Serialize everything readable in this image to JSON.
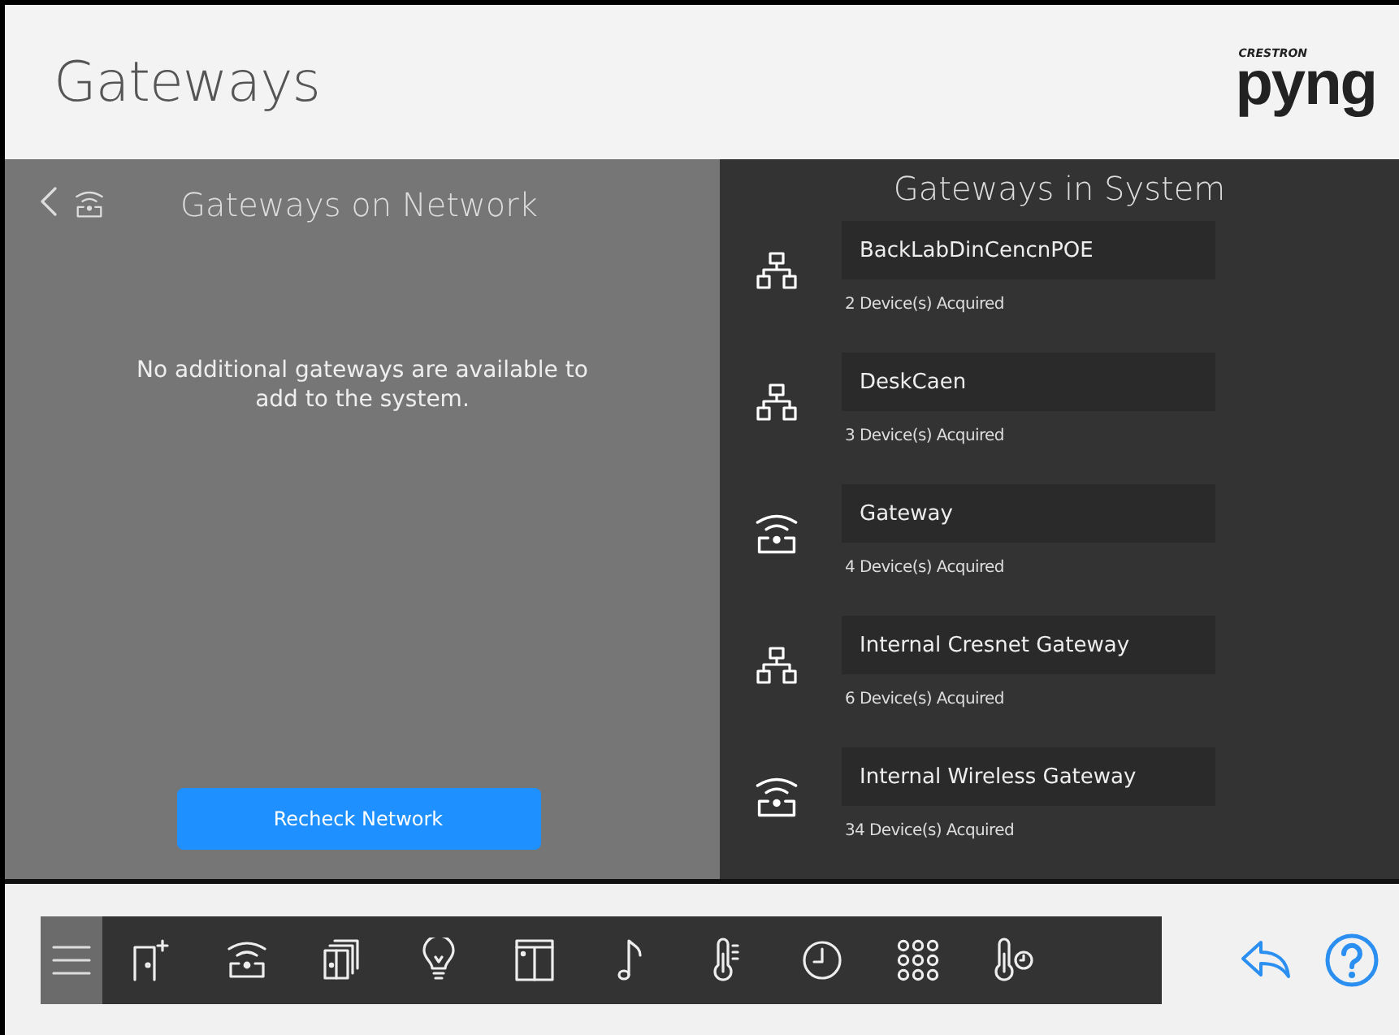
{
  "header": {
    "title": "Gateways",
    "logo": {
      "brand": "CRESTRON",
      "name": "pyng"
    }
  },
  "network_panel": {
    "title": "Gateways on Network",
    "message": "No additional gateways are available to add to the system.",
    "button": "Recheck Network"
  },
  "system_panel": {
    "title": "Gateways in System",
    "gateways": [
      {
        "kind": "wired",
        "name": "BackLabDinCencnPOE",
        "devices": "2 Device(s) Acquired"
      },
      {
        "kind": "wired",
        "name": "DeskCaen",
        "devices": "3 Device(s) Acquired"
      },
      {
        "kind": "wireless",
        "name": "Gateway",
        "devices": "4 Device(s) Acquired"
      },
      {
        "kind": "wired",
        "name": "Internal Cresnet Gateway",
        "devices": "6 Device(s) Acquired"
      },
      {
        "kind": "wireless",
        "name": "Internal Wireless Gateway",
        "devices": "34 Device(s) Acquired"
      }
    ]
  },
  "toolbar": {
    "items": [
      {
        "kind": "menu",
        "selected": true
      },
      {
        "kind": "add-room",
        "selected": false
      },
      {
        "kind": "gateway",
        "selected": false
      },
      {
        "kind": "rooms",
        "selected": false
      },
      {
        "kind": "lighting",
        "selected": false
      },
      {
        "kind": "shades",
        "selected": false
      },
      {
        "kind": "music",
        "selected": false
      },
      {
        "kind": "thermostat",
        "selected": false
      },
      {
        "kind": "clock",
        "selected": false
      },
      {
        "kind": "keypad",
        "selected": false
      },
      {
        "kind": "sensor",
        "selected": false
      }
    ]
  }
}
